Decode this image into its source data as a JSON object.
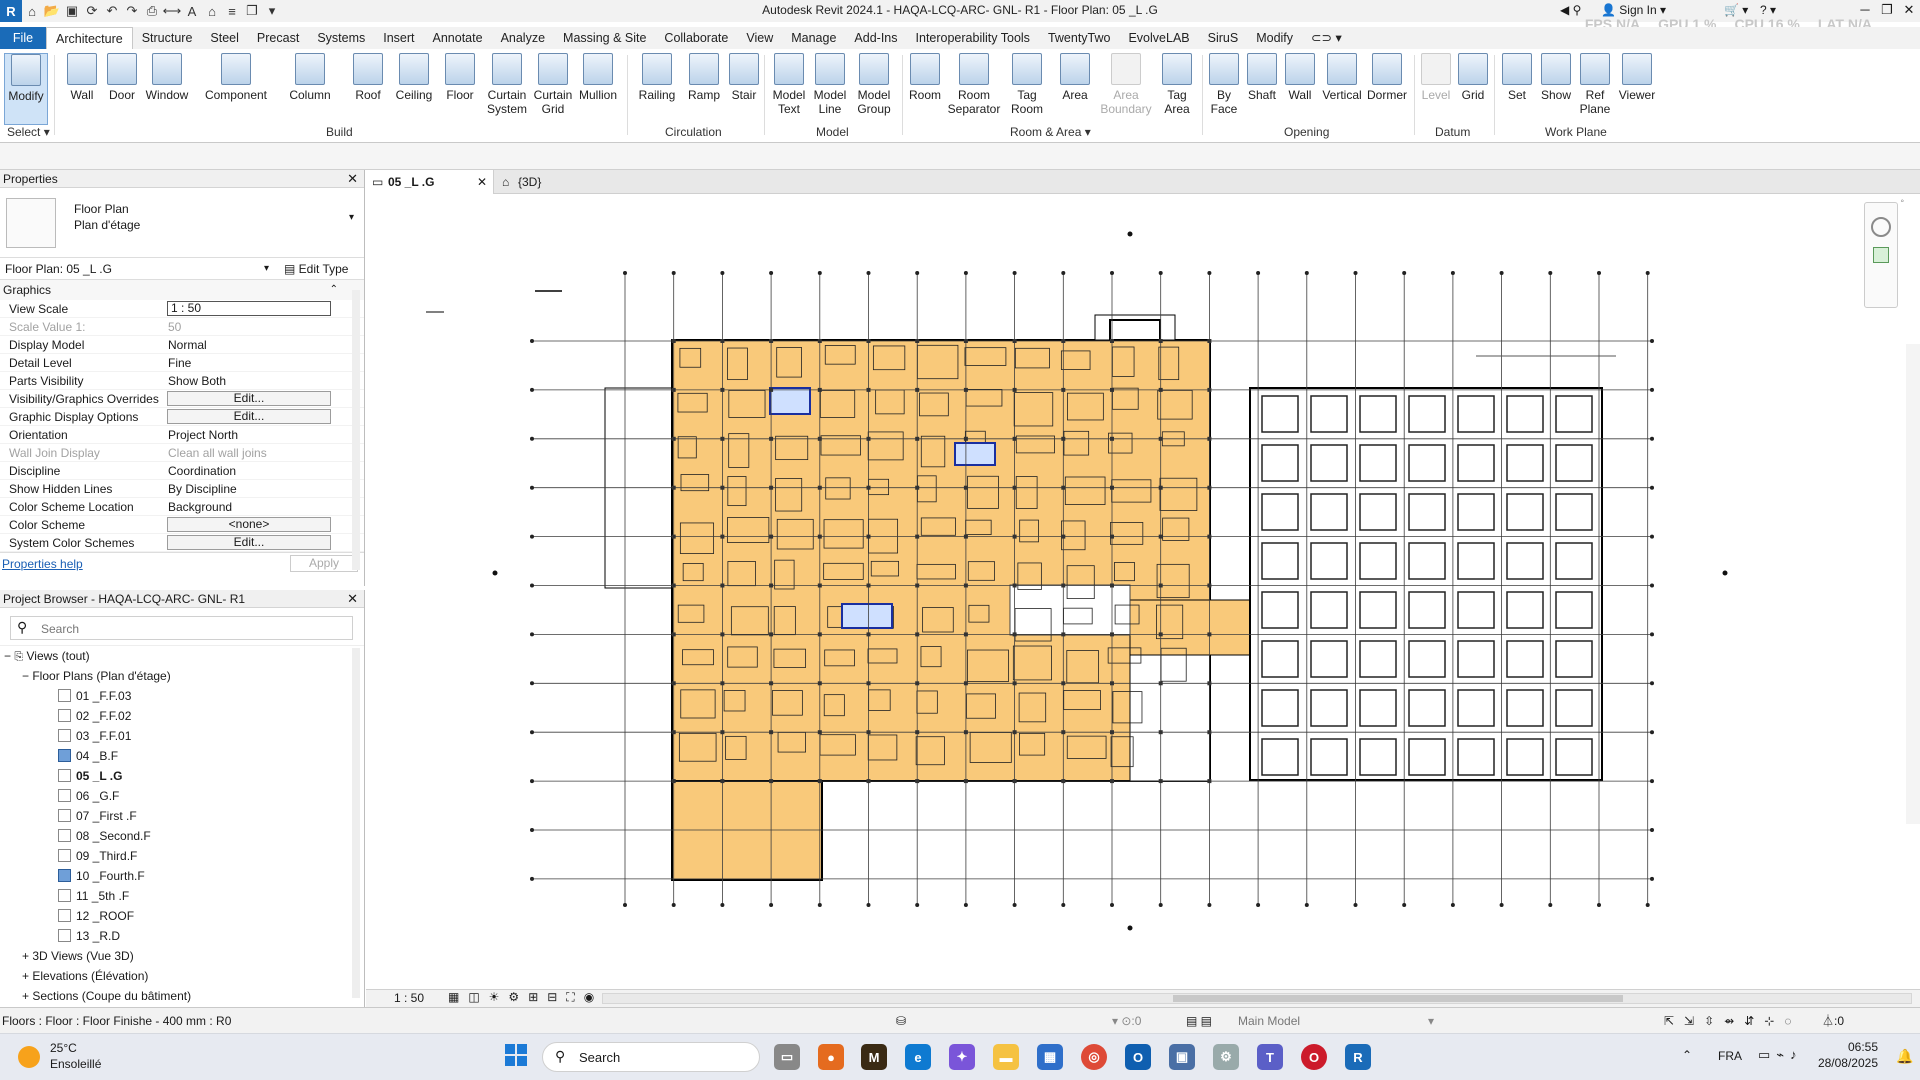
{
  "app": {
    "title": "Autodesk Revit 2024.1 - HAQA-LCQ-ARC- GNL- R1 - Floor Plan: 05 _L .G",
    "sign_in": "Sign In",
    "fps": "FPS N/A",
    "gpu": "GPU 1 %",
    "cpu": "CPU 16 %",
    "lat": "LAT N/A"
  },
  "menu": {
    "tabs": [
      "File",
      "Architecture",
      "Structure",
      "Steel",
      "Precast",
      "Systems",
      "Insert",
      "Annotate",
      "Analyze",
      "Massing & Site",
      "Collaborate",
      "View",
      "Manage",
      "Add-Ins",
      "Interoperability Tools",
      "TwentyTwo",
      "EvolveLAB",
      "SiruS",
      "Modify"
    ],
    "active": "Architecture"
  },
  "ribbon": {
    "select": {
      "modify": "Modify",
      "select_label": "Select"
    },
    "build": {
      "label": "Build",
      "wall": "Wall",
      "door": "Door",
      "window": "Window",
      "component": "Component",
      "column": "Column",
      "roof": "Roof",
      "ceiling": "Ceiling",
      "floor": "Floor",
      "curtain_system": "Curtain\nSystem",
      "curtain_grid": "Curtain\nGrid",
      "mullion": "Mullion"
    },
    "circulation": {
      "label": "Circulation",
      "railing": "Railing",
      "ramp": "Ramp",
      "stair": "Stair"
    },
    "model": {
      "label": "Model",
      "model_text": "Model\nText",
      "model_line": "Model\nLine",
      "model_group": "Model\nGroup"
    },
    "room_area": {
      "label": "Room & Area",
      "room": "Room",
      "room_separator": "Room\nSeparator",
      "tag_room": "Tag\nRoom",
      "area": "Area",
      "area_boundary": "Area\nBoundary",
      "tag_area": "Tag\nArea"
    },
    "opening": {
      "label": "Opening",
      "by_face": "By\nFace",
      "shaft": "Shaft",
      "wall": "Wall",
      "vertical": "Vertical",
      "dormer": "Dormer"
    },
    "datum": {
      "label": "Datum",
      "level": "Level",
      "grid": "Grid"
    },
    "work_plane": {
      "label": "Work Plane",
      "set": "Set",
      "show": "Show",
      "ref_plane": "Ref\nPlane",
      "viewer": "Viewer"
    }
  },
  "properties": {
    "header": "Properties",
    "type_line1": "Floor Plan",
    "type_line2": "Plan d'étage",
    "instance": "Floor Plan: 05 _L .G",
    "edit_type": "Edit Type",
    "section": "Graphics",
    "rows": [
      {
        "k": "View Scale",
        "v": "1 : 50",
        "box": true
      },
      {
        "k": "Scale Value    1:",
        "v": "50",
        "gray": true
      },
      {
        "k": "Display Model",
        "v": "Normal"
      },
      {
        "k": "Detail Level",
        "v": "Fine"
      },
      {
        "k": "Parts Visibility",
        "v": "Show Both"
      },
      {
        "k": "Visibility/Graphics Overrides",
        "v": "Edit...",
        "btn": true
      },
      {
        "k": "Graphic Display Options",
        "v": "Edit...",
        "btn": true
      },
      {
        "k": "Orientation",
        "v": "Project North"
      },
      {
        "k": "Wall Join Display",
        "v": "Clean all wall joins",
        "gray": true
      },
      {
        "k": "Discipline",
        "v": "Coordination"
      },
      {
        "k": "Show Hidden Lines",
        "v": "By Discipline"
      },
      {
        "k": "Color Scheme Location",
        "v": "Background"
      },
      {
        "k": "Color Scheme",
        "v": "<none>",
        "btn": true
      },
      {
        "k": "System Color Schemes",
        "v": "Edit...",
        "btn": true
      }
    ],
    "help": "Properties help",
    "apply": "Apply"
  },
  "browser": {
    "header": "Project Browser - HAQA-LCQ-ARC- GNL- R1",
    "search_placeholder": "Search",
    "views": "Views (tout)",
    "floor_plans": "Floor Plans (Plan d'étage)",
    "items": [
      {
        "label": "01 _F.F.03"
      },
      {
        "label": "02 _F.F.02"
      },
      {
        "label": "03 _F.F.01"
      },
      {
        "label": "04 _B.F",
        "blue": true
      },
      {
        "label": "05 _L .G",
        "bold": true
      },
      {
        "label": "06 _G.F"
      },
      {
        "label": "07 _First .F"
      },
      {
        "label": "08 _Second.F"
      },
      {
        "label": "09 _Third.F"
      },
      {
        "label": "10 _Fourth.F",
        "blue": true
      },
      {
        "label": "11 _5th .F"
      },
      {
        "label": "12 _ROOF"
      },
      {
        "label": "13 _R.D"
      }
    ],
    "views_3d": "3D Views (Vue 3D)",
    "elevations": "Elevations (Élévation)",
    "sections": "Sections (Coupe du bâtiment)"
  },
  "view_tabs": [
    {
      "label": "05 _L .G",
      "active": true
    },
    {
      "label": "{3D}"
    }
  ],
  "viewbar": {
    "scale": "1 : 50"
  },
  "status": {
    "text": "Floors : Floor : Floor Finishe - 400 mm : R0",
    "count": ":0",
    "model": "Main Model",
    "filter": ":0"
  },
  "taskbar": {
    "temp": "25°C",
    "weather": "Ensoleillé",
    "search": "Search",
    "lang": "FRA",
    "time": "06:55",
    "date": "28/08/2025"
  },
  "colors": {
    "accent": "#1a6bb8",
    "plan_fill": "#f9c97a",
    "grid_line": "#3d3d3d"
  }
}
